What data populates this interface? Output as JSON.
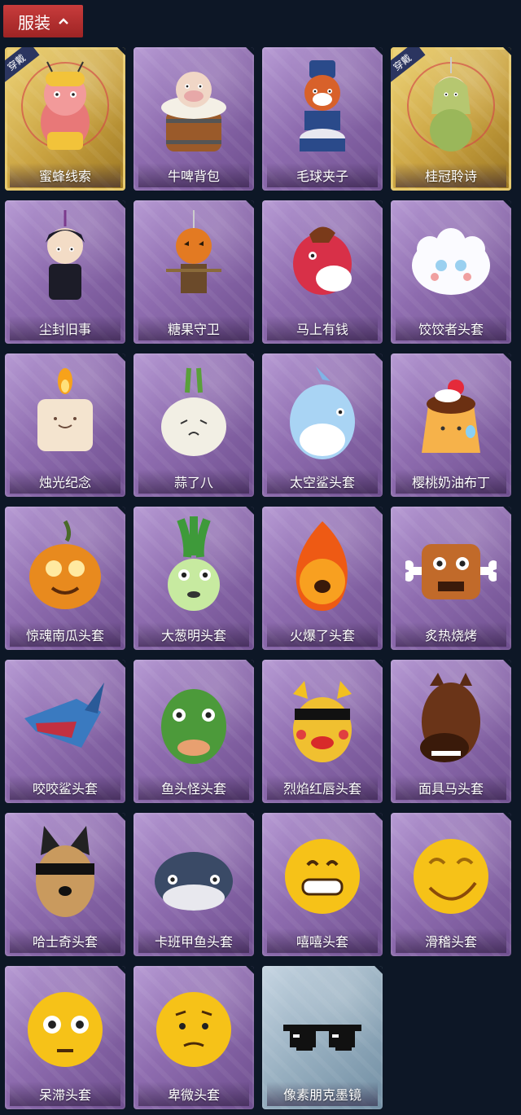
{
  "header": {
    "title": "服装",
    "toggle_icon": "chevron-up-icon"
  },
  "equipped_badge": "穿戴",
  "items": [
    {
      "name": "蜜蜂线索",
      "equipped": true,
      "frame": "gold",
      "icon": "bee-mascot-icon"
    },
    {
      "name": "牛啤背包",
      "equipped": false,
      "frame": "purple",
      "icon": "cow-barrel-icon"
    },
    {
      "name": "毛球夹子",
      "equipped": false,
      "frame": "purple",
      "icon": "fox-drummer-icon"
    },
    {
      "name": "桂冠聆诗",
      "equipped": true,
      "frame": "gold",
      "icon": "laurel-doll-icon"
    },
    {
      "name": "尘封旧事",
      "equipped": false,
      "frame": "purple",
      "icon": "dark-doll-icon"
    },
    {
      "name": "糖果守卫",
      "equipped": false,
      "frame": "purple",
      "icon": "pumpkin-scarecrow-icon"
    },
    {
      "name": "马上有钱",
      "equipped": false,
      "frame": "purple",
      "icon": "red-horse-icon"
    },
    {
      "name": "饺饺者头套",
      "equipped": false,
      "frame": "purple",
      "icon": "dumpling-head-icon"
    },
    {
      "name": "烛光纪念",
      "equipped": false,
      "frame": "purple",
      "icon": "candle-icon"
    },
    {
      "name": "蒜了八",
      "equipped": false,
      "frame": "purple",
      "icon": "garlic-icon"
    },
    {
      "name": "太空鲨头套",
      "equipped": false,
      "frame": "purple",
      "icon": "space-shark-icon"
    },
    {
      "name": "樱桃奶油布丁",
      "equipped": false,
      "frame": "purple",
      "icon": "pudding-icon"
    },
    {
      "name": "惊魂南瓜头套",
      "equipped": false,
      "frame": "purple",
      "icon": "pumpkin-icon"
    },
    {
      "name": "大葱明头套",
      "equipped": false,
      "frame": "purple",
      "icon": "leek-icon"
    },
    {
      "name": "火爆了头套",
      "equipped": false,
      "frame": "purple",
      "icon": "fire-head-icon"
    },
    {
      "name": "炙热烧烤",
      "equipped": false,
      "frame": "purple",
      "icon": "meat-icon"
    },
    {
      "name": "咬咬鲨头套",
      "equipped": false,
      "frame": "purple",
      "icon": "shark-icon"
    },
    {
      "name": "鱼头怪头套",
      "equipped": false,
      "frame": "purple",
      "icon": "fish-head-icon"
    },
    {
      "name": "烈焰红唇头套",
      "equipped": false,
      "frame": "purple",
      "icon": "yellow-mask-icon"
    },
    {
      "name": "面具马头套",
      "equipped": false,
      "frame": "purple",
      "icon": "horse-head-icon"
    },
    {
      "name": "哈士奇头套",
      "equipped": false,
      "frame": "purple",
      "icon": "husky-icon"
    },
    {
      "name": "卡班甲鱼头套",
      "equipped": false,
      "frame": "purple",
      "icon": "blue-fish-icon"
    },
    {
      "name": "嘻嘻头套",
      "equipped": false,
      "frame": "purple",
      "icon": "grin-emoji-icon"
    },
    {
      "name": "滑稽头套",
      "equipped": false,
      "frame": "purple",
      "icon": "smirk-emoji-icon"
    },
    {
      "name": "呆滞头套",
      "equipped": false,
      "frame": "purple",
      "icon": "stare-emoji-icon"
    },
    {
      "name": "卑微头套",
      "equipped": false,
      "frame": "purple",
      "icon": "humble-emoji-icon"
    },
    {
      "name": "像素朋克墨镜",
      "equipped": false,
      "frame": "blue",
      "icon": "pixel-glasses-icon"
    }
  ],
  "colors": {
    "background": "#0d1726",
    "header": "#b93030",
    "card_purple": "#8e6caf",
    "card_gold": "#c9a240",
    "card_blue": "#96aebf"
  }
}
